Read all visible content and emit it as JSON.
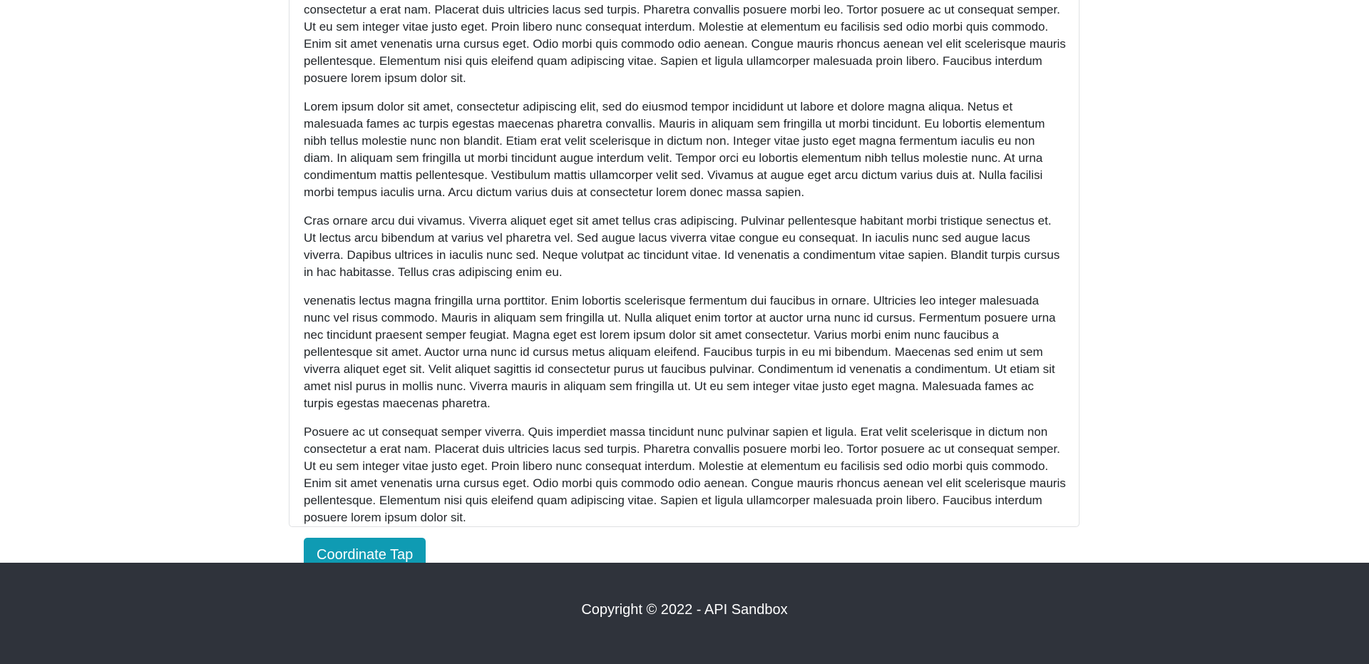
{
  "content": {
    "paragraphs": [
      "Posuere ac ut consequat semper viverra. Quis imperdiet massa tincidunt nunc pulvinar sapien et ligula. Erat velit scelerisque in dictum non consectetur a erat nam. Placerat duis ultricies lacus sed turpis. Pharetra convallis posuere morbi leo. Tortor posuere ac ut consequat semper. Ut eu sem integer vitae justo eget. Proin libero nunc consequat interdum. Molestie at elementum eu facilisis sed odio morbi quis commodo. Enim sit amet venenatis urna cursus eget. Odio morbi quis commodo odio aenean. Congue mauris rhoncus aenean vel elit scelerisque mauris pellentesque. Elementum nisi quis eleifend quam adipiscing vitae. Sapien et ligula ullamcorper malesuada proin libero. Faucibus interdum posuere lorem ipsum dolor sit.",
      "Lorem ipsum dolor sit amet, consectetur adipiscing elit, sed do eiusmod tempor incididunt ut labore et dolore magna aliqua. Netus et malesuada fames ac turpis egestas maecenas pharetra convallis. Mauris in aliquam sem fringilla ut morbi tincidunt. Eu lobortis elementum nibh tellus molestie nunc non blandit. Etiam erat velit scelerisque in dictum non. Integer vitae justo eget magna fermentum iaculis eu non diam. In aliquam sem fringilla ut morbi tincidunt augue interdum velit. Tempor orci eu lobortis elementum nibh tellus molestie nunc. At urna condimentum mattis pellentesque. Vestibulum mattis ullamcorper velit sed. Vivamus at augue eget arcu dictum varius duis at. Nulla facilisi morbi tempus iaculis urna. Arcu dictum varius duis at consectetur lorem donec massa sapien.",
      "Cras ornare arcu dui vivamus. Viverra aliquet eget sit amet tellus cras adipiscing. Pulvinar pellentesque habitant morbi tristique senectus et. Ut lectus arcu bibendum at varius vel pharetra vel. Sed augue lacus viverra vitae congue eu consequat. In iaculis nunc sed augue lacus viverra. Dapibus ultrices in iaculis nunc sed. Neque volutpat ac tincidunt vitae. Id venenatis a condimentum vitae sapien. Blandit turpis cursus in hac habitasse. Tellus cras adipiscing enim eu.",
      "venenatis lectus magna fringilla urna porttitor. Enim lobortis scelerisque fermentum dui faucibus in ornare. Ultricies leo integer malesuada nunc vel risus commodo. Mauris in aliquam sem fringilla ut. Nulla aliquet enim tortor at auctor urna nunc id cursus. Fermentum posuere urna nec tincidunt praesent semper feugiat. Magna eget est lorem ipsum dolor sit amet consectetur. Varius morbi enim nunc faucibus a pellentesque sit amet. Auctor urna nunc id cursus metus aliquam eleifend. Faucibus turpis in eu mi bibendum. Maecenas sed enim ut sem viverra aliquet eget sit. Velit aliquet sagittis id consectetur purus ut faucibus pulvinar. Condimentum id venenatis a condimentum. Ut etiam sit amet nisl purus in mollis nunc. Viverra mauris in aliquam sem fringilla ut. Ut eu sem integer vitae justo eget magna. Malesuada fames ac turpis egestas maecenas pharetra.",
      "Posuere ac ut consequat semper viverra. Quis imperdiet massa tincidunt nunc pulvinar sapien et ligula. Erat velit scelerisque in dictum non consectetur a erat nam. Placerat duis ultricies lacus sed turpis. Pharetra convallis posuere morbi leo. Tortor posuere ac ut consequat semper. Ut eu sem integer vitae justo eget. Proin libero nunc consequat interdum. Molestie at elementum eu facilisis sed odio morbi quis commodo. Enim sit amet venenatis urna cursus eget. Odio morbi quis commodo odio aenean. Congue mauris rhoncus aenean vel elit scelerisque mauris pellentesque. Elementum nisi quis eleifend quam adipiscing vitae. Sapien et ligula ullamcorper malesuada proin libero. Faucibus interdum posuere lorem ipsum dolor sit."
    ],
    "button_label": "Coordinate Tap"
  },
  "footer": {
    "text": "Copyright © 2022 - API Sandbox"
  },
  "colors": {
    "button": "#0f9bb3",
    "footer_background": "#2f333b",
    "card_border": "#dfe1e3"
  }
}
